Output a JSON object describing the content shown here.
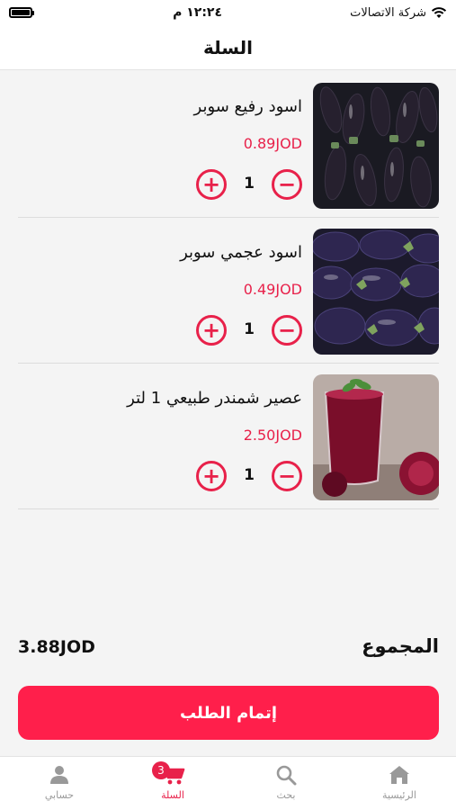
{
  "status_bar": {
    "carrier": "شركة الاتصالات",
    "time": "١٢:٢٤ م"
  },
  "header": {
    "title": "السلة"
  },
  "items": [
    {
      "name": "اسود رفيع سوبر",
      "price": "0.89JOD",
      "quantity": "1",
      "image": "thin-eggplants"
    },
    {
      "name": "اسود عجمي  سوبر",
      "price": "0.49JOD",
      "quantity": "1",
      "image": "round-eggplants"
    },
    {
      "name": "عصير شمندر طبيعي 1 لتر",
      "price": "2.50JOD",
      "quantity": "1",
      "image": "beet-juice"
    }
  ],
  "summary": {
    "total_label": "المجموع",
    "total_value": "3.88JOD"
  },
  "checkout": {
    "label": "إتمام الطلب"
  },
  "tabbar": {
    "tabs": [
      {
        "label": "الرئيسية",
        "icon": "home-icon"
      },
      {
        "label": "بحث",
        "icon": "search-icon"
      },
      {
        "label": "السلة",
        "icon": "cart-icon",
        "badge": "3",
        "active": true
      },
      {
        "label": "حسابي",
        "icon": "user-icon"
      }
    ]
  },
  "colors": {
    "accent": "#e8214a",
    "button": "#ff1f4b"
  }
}
